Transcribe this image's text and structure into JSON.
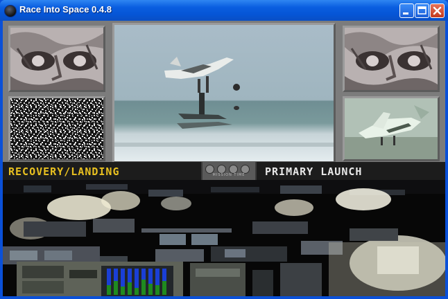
{
  "window": {
    "title": "Race Into Space 0.4.8",
    "app_icon": "app-icon",
    "controls": {
      "minimize_icon": "minimize-icon",
      "maximize_icon": "maximize-icon",
      "close_icon": "close-icon"
    }
  },
  "screen": {
    "left_label": "RECOVERY/LANDING",
    "right_label": "PRIMARY LAUNCH",
    "center_caption": "MISSION TIME"
  },
  "colors": {
    "title_bar": "#0a5ee0",
    "left_label": "#e8c020",
    "right_label": "#e8e8e8",
    "gauge_blue": "#1a3fd6",
    "gauge_green": "#1f8a1f"
  }
}
